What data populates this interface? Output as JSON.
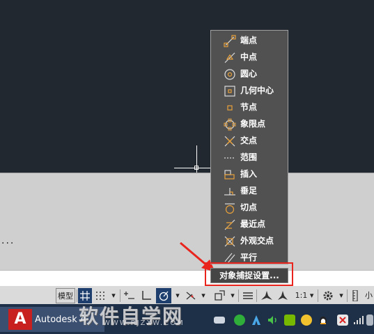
{
  "snap_menu": {
    "items": [
      {
        "label": "端点",
        "icon": "endpoint-icon"
      },
      {
        "label": "中点",
        "icon": "midpoint-icon"
      },
      {
        "label": "圆心",
        "icon": "center-icon"
      },
      {
        "label": "几何中心",
        "icon": "geometric-center-icon"
      },
      {
        "label": "节点",
        "icon": "node-icon"
      },
      {
        "label": "象限点",
        "icon": "quadrant-icon"
      },
      {
        "label": "交点",
        "icon": "intersection-icon"
      },
      {
        "label": "范围",
        "icon": "extension-icon"
      },
      {
        "label": "插入",
        "icon": "insertion-icon"
      },
      {
        "label": "垂足",
        "icon": "perpendicular-icon"
      },
      {
        "label": "切点",
        "icon": "tangent-icon"
      },
      {
        "label": "最近点",
        "icon": "nearest-icon"
      },
      {
        "label": "外观交点",
        "icon": "apparent-intersection-icon"
      },
      {
        "label": "平行",
        "icon": "parallel-icon"
      }
    ],
    "settings_label": "对象捕捉设置..."
  },
  "canvas": {
    "ellipsis": "..."
  },
  "status_bar": {
    "model_label": "模型",
    "scale_label": "1:1",
    "scale_dropdown": "▾",
    "trailing": "小"
  },
  "taskbar": {
    "app_title": "Autodesk A",
    "app_logo_letter": "A"
  },
  "watermark": {
    "main": "软件自学网",
    "url": "WWW.RJZXW.COM"
  },
  "colors": {
    "canvas_bg": "#212830",
    "menu_bg": "#515151",
    "icon_orange": "#e8a13a",
    "highlight_red": "#e8241d",
    "active_blue": "#1e3f6e"
  }
}
